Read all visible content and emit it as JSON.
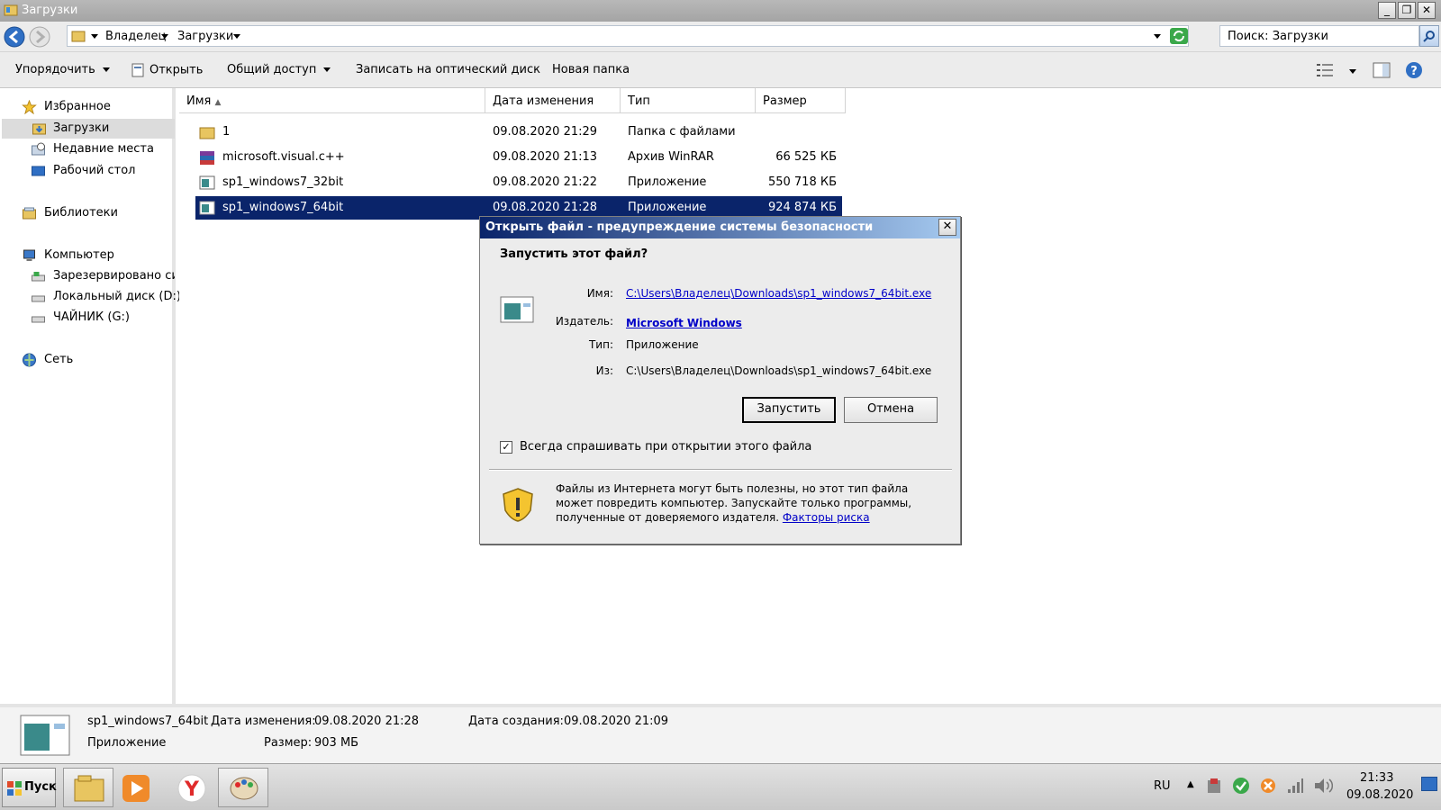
{
  "window": {
    "title": "Загрузки",
    "min_glyph": "_",
    "restore_glyph": "❐",
    "close_glyph": "✕"
  },
  "address": {
    "crumbs": [
      "Владелец",
      "Загрузки"
    ],
    "search_placeholder": "Поиск: Загрузки"
  },
  "toolbar": {
    "organize": "Упорядочить",
    "open": "Открыть",
    "share": "Общий доступ",
    "burn": "Записать на оптический диск",
    "new_folder": "Новая папка"
  },
  "sidebar": {
    "favorites": "Избранное",
    "downloads": "Загрузки",
    "recent": "Недавние места",
    "desktop": "Рабочий стол",
    "libraries": "Библиотеки",
    "computer": "Компьютер",
    "reserved": "Зарезервировано сис",
    "local_d": "Локальный диск (D:)",
    "drive_g": "ЧАЙНИК (G:)",
    "network": "Сеть"
  },
  "columns": {
    "name": "Имя",
    "date": "Дата изменения",
    "type": "Тип",
    "size": "Размер"
  },
  "files": [
    {
      "name": "1",
      "date": "09.08.2020 21:29",
      "type": "Папка с файлами",
      "size": ""
    },
    {
      "name": "microsoft.visual.c++",
      "date": "09.08.2020 21:13",
      "type": "Архив WinRAR",
      "size": "66 525 КБ"
    },
    {
      "name": "sp1_windows7_32bit",
      "date": "09.08.2020 21:22",
      "type": "Приложение",
      "size": "550 718 КБ"
    },
    {
      "name": "sp1_windows7_64bit",
      "date": "09.08.2020 21:28",
      "type": "Приложение",
      "size": "924 874 КБ"
    }
  ],
  "details": {
    "name": "sp1_windows7_64bit",
    "modified_label": "Дата изменения:",
    "modified_value": "09.08.2020 21:28",
    "created_label": "Дата создания:",
    "created_value": "09.08.2020 21:09",
    "type": "Приложение",
    "size_label": "Размер:",
    "size_value": "903 МБ"
  },
  "dialog": {
    "title": "Открыть файл - предупреждение системы безопасности",
    "question": "Запустить этот файл?",
    "name_label": "Имя:",
    "name_value": "C:\\Users\\Владелец\\Downloads\\sp1_windows7_64bit.exe",
    "publisher_label": "Издатель:",
    "publisher_value": "Microsoft Windows",
    "type_label": "Тип:",
    "type_value": "Приложение",
    "from_label": "Из:",
    "from_value": "C:\\Users\\Владелец\\Downloads\\sp1_windows7_64bit.exe",
    "run_button": "Запустить",
    "cancel_button": "Отмена",
    "checkbox_label": "Всегда спрашивать при открытии этого файла",
    "checkbox_checked": true,
    "warning_text": "Файлы из Интернета могут быть полезны, но этот тип файла может повредить компьютер. Запускайте только программы, полученные от доверяемого издателя.",
    "risk_link": "Факторы риска"
  },
  "taskbar": {
    "start": "Пуск",
    "lang": "RU",
    "time": "21:33",
    "date": "09.08.2020"
  },
  "colors": {
    "selection": "#0a246a",
    "link": "#0000c8",
    "dialog_title_start": "#0a246a",
    "dialog_title_end": "#a6caf0"
  }
}
